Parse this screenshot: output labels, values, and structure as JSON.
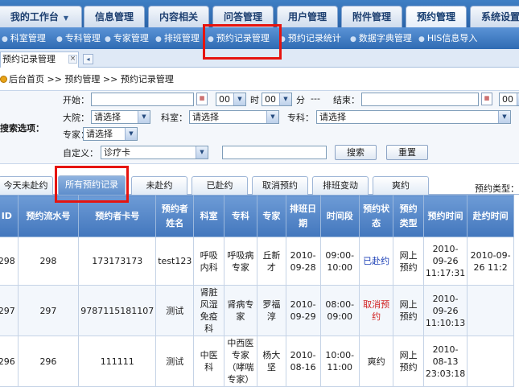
{
  "top_nav": {
    "tabs": [
      {
        "label": "我的工作台",
        "has_dropdown": true
      },
      {
        "label": "信息管理"
      },
      {
        "label": "内容相关"
      },
      {
        "label": "问答管理"
      },
      {
        "label": "用户管理"
      },
      {
        "label": "附件管理"
      },
      {
        "label": "预约管理",
        "active": true
      },
      {
        "label": "系统设置"
      }
    ]
  },
  "sub_nav": {
    "items": [
      "科室管理",
      "专科管理",
      "专家管理",
      "排班管理",
      "预约记录管理",
      "预约记录统计",
      "数据字典管理",
      "HIS信息导入"
    ]
  },
  "doc_tab": {
    "label": "预约记录管理",
    "close": "×",
    "menu": "◂"
  },
  "breadcrumb": {
    "text": "后台首页 >> 预约管理 >> 预约记录管理"
  },
  "search": {
    "title": "搜索选项：",
    "start_label": "开始：",
    "end_label": "结束：",
    "hour_value": "00",
    "hour_unit": "时",
    "minute_value": "00",
    "minute_unit": "分",
    "range_sep": "---",
    "hospital_label": "大院：",
    "dept_label": "科室：",
    "specialty_label": "专科：",
    "expert_label": "专家：",
    "custom_label": "自定义：",
    "placeholder_select": "请选择",
    "custom_field_value": "诊疗卡",
    "search_button": "搜索",
    "reset_button": "重置"
  },
  "filter_tabs": {
    "items": [
      "今天未赴约",
      "所有预约记录",
      "未赴约",
      "已赴约",
      "取消预约",
      "排班变动",
      "爽约"
    ],
    "active_index": 1,
    "type_label": "预约类型："
  },
  "table": {
    "headers": [
      "ID",
      "预约流水号",
      "预约者卡号",
      "预约者姓名",
      "科室",
      "专科",
      "专家",
      "排班日期",
      "时间段",
      "预约状态",
      "预约类型",
      "预约时间",
      "赴约时间"
    ],
    "rows": [
      {
        "id": "298",
        "serial": "298",
        "card": "173173173",
        "name": "test123",
        "dept": "呼吸内科",
        "specialty": "呼吸病专家",
        "expert": "丘新才",
        "date": "2010-09-28",
        "time": "09:00-10:00",
        "status": "已赴约",
        "status_kind": "arrived",
        "type": "网上预约",
        "booked": "2010-09-26 11:17:31",
        "visit": "2010-09-26 11:2"
      },
      {
        "id": "297",
        "serial": "297",
        "card": "9787115181107",
        "name": "测试",
        "dept": "肾脏风湿免疫科",
        "specialty": "肾病专家",
        "expert": "罗福淳",
        "date": "2010-09-29",
        "time": "08:00-09:00",
        "status": "取消预约",
        "status_kind": "cancel",
        "type": "网上预约",
        "booked": "2010-09-26 11:10:13",
        "visit": ""
      },
      {
        "id": "296",
        "serial": "296",
        "card": "111111",
        "name": "测试",
        "dept": "中医科",
        "specialty": "中西医专家（哮喘专家）",
        "expert": "杨大坚",
        "date": "2010-08-16",
        "time": "10:00-11:00",
        "status": "爽约",
        "status_kind": "miss",
        "type": "网上预约",
        "booked": "2010-08-13 23:03:18",
        "visit": ""
      }
    ]
  },
  "colors": {
    "highlight": "#e6140f",
    "nav": "#2a63a8",
    "header": "#4377bd"
  }
}
